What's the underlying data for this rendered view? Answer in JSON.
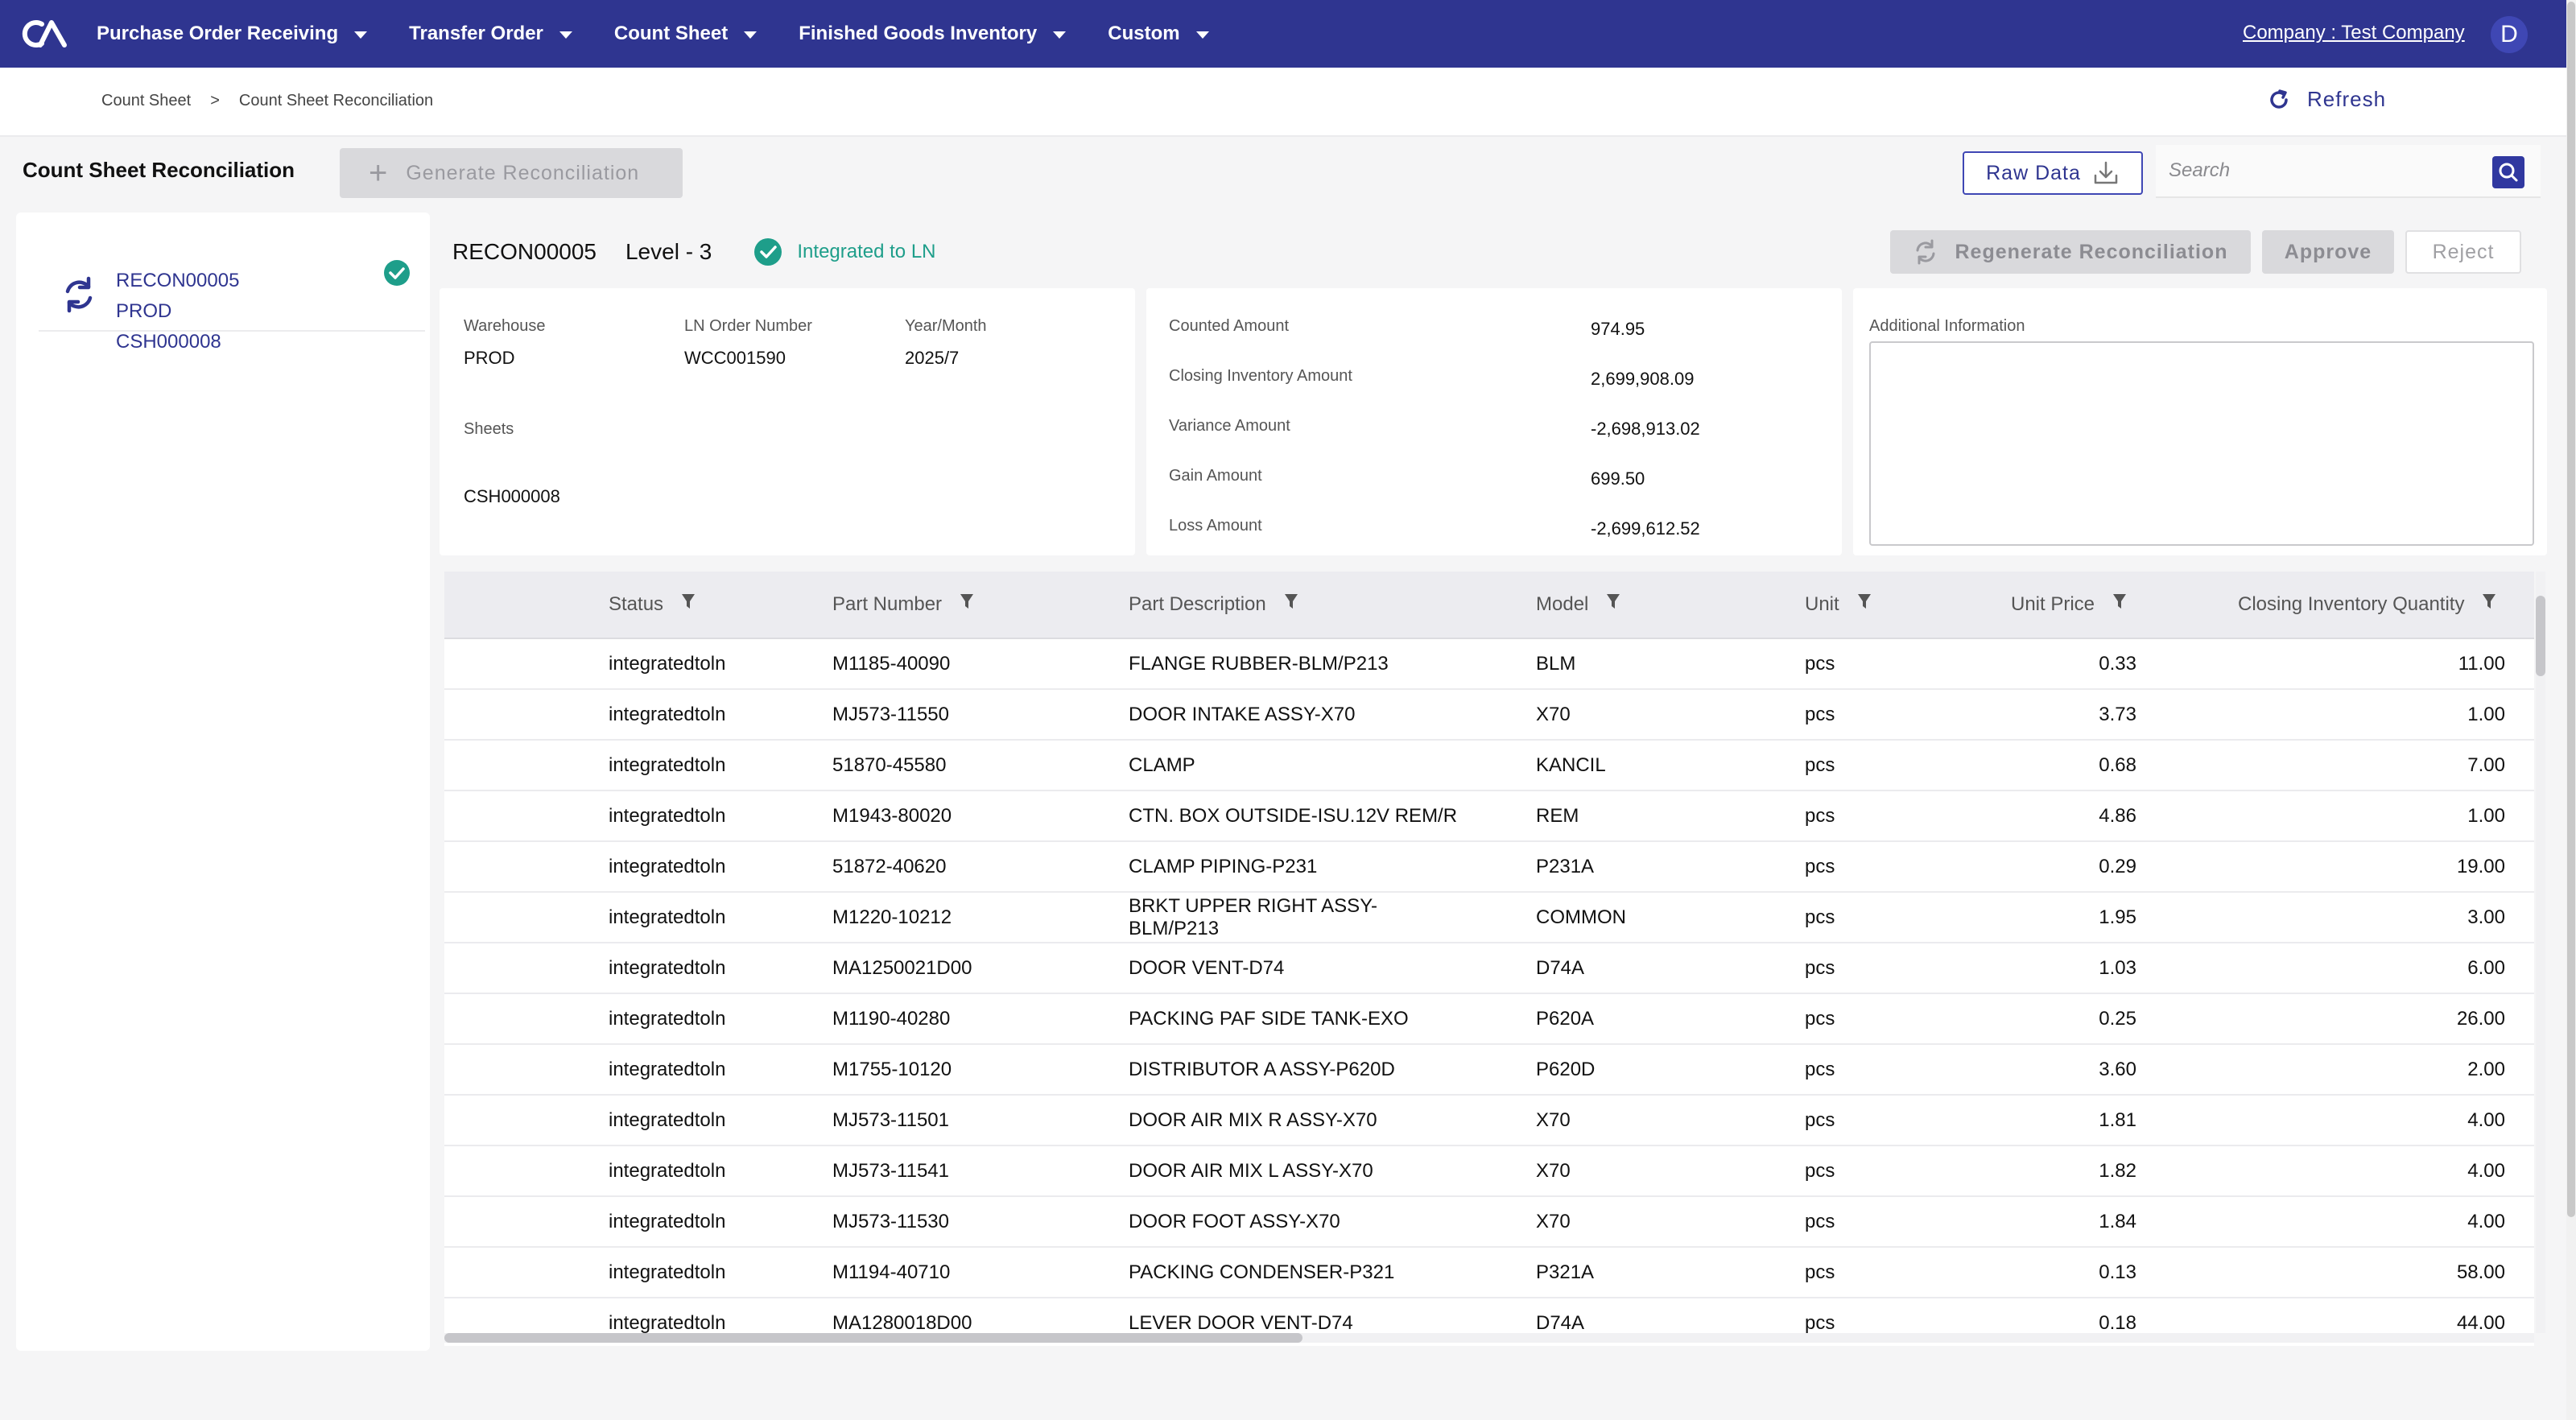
{
  "nav": {
    "items": [
      {
        "label": "Purchase Order Receiving"
      },
      {
        "label": "Transfer Order"
      },
      {
        "label": "Count Sheet"
      },
      {
        "label": "Finished Goods Inventory"
      },
      {
        "label": "Custom"
      }
    ],
    "company": "Company : Test Company",
    "avatar_initial": "D",
    "brand_color": "#2f3590"
  },
  "breadcrumb": {
    "items": [
      "Count Sheet",
      ">",
      "Count Sheet Reconciliation"
    ],
    "refresh_label": "Refresh"
  },
  "toolbar": {
    "title": "Count Sheet Reconciliation",
    "generate_label": "Generate Reconciliation",
    "raw_data_label": "Raw Data",
    "search_placeholder": "Search"
  },
  "list": {
    "items": [
      {
        "id": "RECON00005",
        "warehouse": "PROD",
        "sheet": "CSH000008",
        "status_icon": "check-circle-icon"
      }
    ]
  },
  "detail": {
    "id": "RECON00005",
    "level": "Level - 3",
    "status": "Integrated to LN",
    "status_color": "#1e9e8a",
    "actions": {
      "regenerate": "Regenerate Reconciliation",
      "approve": "Approve",
      "reject": "Reject"
    },
    "info": {
      "warehouse_label": "Warehouse",
      "warehouse": "PROD",
      "ln_order_label": "LN Order Number",
      "ln_order": "WCC001590",
      "year_month_label": "Year/Month",
      "year_month": "2025/7",
      "sheets_label": "Sheets",
      "sheets": "CSH000008"
    },
    "amounts": [
      {
        "label": "Counted Amount",
        "value": "974.95"
      },
      {
        "label": "Closing Inventory Amount",
        "value": "2,699,908.09"
      },
      {
        "label": "Variance Amount",
        "value": "-2,698,913.02"
      },
      {
        "label": "Gain Amount",
        "value": "699.50"
      },
      {
        "label": "Loss Amount",
        "value": "-2,699,612.52"
      }
    ],
    "additional_label": "Additional Information",
    "additional_value": ""
  },
  "table": {
    "columns": [
      "Status",
      "Part Number",
      "Part Description",
      "Model",
      "Unit",
      "Unit Price",
      "Closing Inventory Quantity"
    ],
    "rows": [
      [
        "integratedtoln",
        "M1185-40090",
        "FLANGE RUBBER-BLM/P213",
        "BLM",
        "pcs",
        "0.33",
        "11.00"
      ],
      [
        "integratedtoln",
        "MJ573-11550",
        "DOOR INTAKE ASSY-X70",
        "X70",
        "pcs",
        "3.73",
        "1.00"
      ],
      [
        "integratedtoln",
        "51870-45580",
        "CLAMP",
        "KANCIL",
        "pcs",
        "0.68",
        "7.00"
      ],
      [
        "integratedtoln",
        "M1943-80020",
        "CTN. BOX OUTSIDE-ISU.12V REM/R",
        "REM",
        "pcs",
        "4.86",
        "1.00"
      ],
      [
        "integratedtoln",
        "51872-40620",
        "CLAMP PIPING-P231",
        "P231A",
        "pcs",
        "0.29",
        "19.00"
      ],
      [
        "integratedtoln",
        "M1220-10212",
        "BRKT UPPER RIGHT ASSY-\nBLM/P213",
        "COMMON",
        "pcs",
        "1.95",
        "3.00"
      ],
      [
        "integratedtoln",
        "MA1250021D00",
        "DOOR VENT-D74",
        "D74A",
        "pcs",
        "1.03",
        "6.00"
      ],
      [
        "integratedtoln",
        "M1190-40280",
        "PACKING PAF SIDE TANK-EXO",
        "P620A",
        "pcs",
        "0.25",
        "26.00"
      ],
      [
        "integratedtoln",
        "M1755-10120",
        "DISTRIBUTOR A ASSY-P620D",
        "P620D",
        "pcs",
        "3.60",
        "2.00"
      ],
      [
        "integratedtoln",
        "MJ573-11501",
        "DOOR AIR MIX R ASSY-X70",
        "X70",
        "pcs",
        "1.81",
        "4.00"
      ],
      [
        "integratedtoln",
        "MJ573-11541",
        "DOOR AIR MIX L ASSY-X70",
        "X70",
        "pcs",
        "1.82",
        "4.00"
      ],
      [
        "integratedtoln",
        "MJ573-11530",
        "DOOR FOOT ASSY-X70",
        "X70",
        "pcs",
        "1.84",
        "4.00"
      ],
      [
        "integratedtoln",
        "M1194-40710",
        "PACKING CONDENSER-P321",
        "P321A",
        "pcs",
        "0.13",
        "58.00"
      ],
      [
        "integratedtoln",
        "MA1280018D00",
        "LEVER DOOR VENT-D74",
        "D74A",
        "pcs",
        "0.18",
        "44.00"
      ]
    ]
  }
}
